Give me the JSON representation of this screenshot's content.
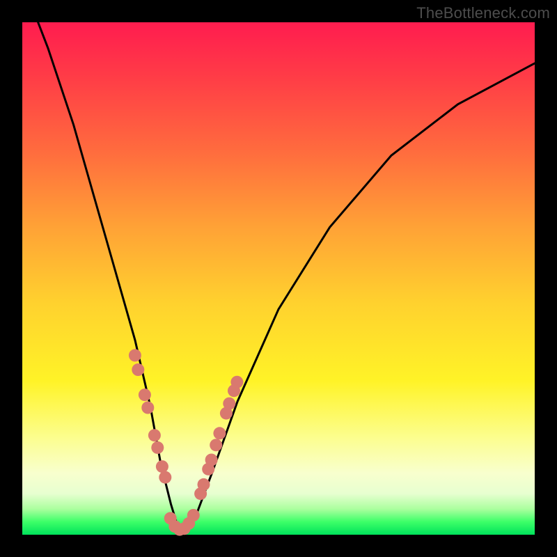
{
  "watermark": "TheBottleneck.com",
  "chart_data": {
    "type": "line",
    "title": "",
    "xlabel": "",
    "ylabel": "",
    "xlim": [
      0,
      100
    ],
    "ylim": [
      0,
      100
    ],
    "series": [
      {
        "name": "bottleneck-curve",
        "x": [
          0,
          5,
          10,
          14,
          18,
          22,
          25,
          27,
          29,
          30.5,
          32,
          34,
          37,
          42,
          50,
          60,
          72,
          85,
          100
        ],
        "y": [
          108,
          95,
          80,
          66,
          52,
          38,
          25,
          14,
          6,
          1,
          1,
          4,
          12,
          26,
          44,
          60,
          74,
          84,
          92
        ]
      }
    ],
    "marker_segments": [
      {
        "name": "left-descent-markers",
        "x": [
          22.0,
          22.6,
          23.9,
          24.5,
          25.8,
          26.4,
          27.3,
          27.9
        ],
        "y": [
          35.0,
          32.2,
          27.3,
          24.8,
          19.4,
          17.0,
          13.3,
          11.2
        ]
      },
      {
        "name": "valley-markers",
        "x": [
          28.9,
          29.8,
          30.7,
          31.6,
          32.5,
          33.4
        ],
        "y": [
          3.2,
          1.6,
          1.0,
          1.2,
          2.2,
          3.8
        ]
      },
      {
        "name": "right-ascent-markers",
        "x": [
          34.8,
          35.4,
          36.3,
          36.9,
          37.8,
          38.5,
          39.8,
          40.4,
          41.3,
          41.9
        ],
        "y": [
          8.0,
          9.8,
          12.8,
          14.6,
          17.5,
          19.8,
          23.7,
          25.6,
          28.1,
          29.8
        ]
      }
    ],
    "colors": {
      "curve": "#000000",
      "markers": "#d9796f"
    }
  }
}
